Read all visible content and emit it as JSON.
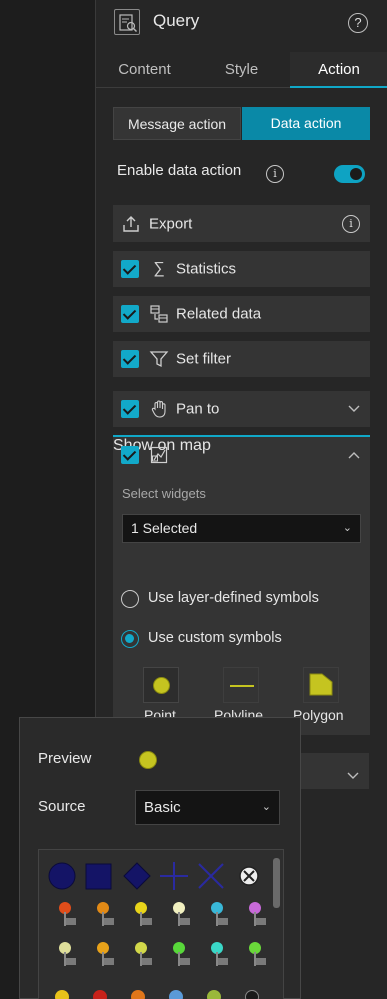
{
  "header": {
    "title": "Query",
    "help": "?"
  },
  "tabs": [
    {
      "label": "Content"
    },
    {
      "label": "Style"
    },
    {
      "label": "Action"
    }
  ],
  "segmented": {
    "message_action": "Message action",
    "data_action": "Data action"
  },
  "enable": {
    "label": "Enable data action",
    "enabled": true
  },
  "actions": {
    "export": "Export",
    "statistics": "Statistics",
    "related_data": "Related data",
    "set_filter": "Set filter",
    "pan_to": "Pan to",
    "show_on_map": "Show on map"
  },
  "show_on_map": {
    "select_widgets_label": "Select widgets",
    "select_widgets_value": "1 Selected",
    "radio_layer": "Use layer-defined symbols",
    "radio_custom": "Use custom symbols",
    "symbol_types": {
      "point": "Point",
      "polyline": "Polyline",
      "polygon": "Polygon"
    }
  },
  "symbol_popup": {
    "preview_label": "Preview",
    "source_label": "Source",
    "source_value": "Basic"
  },
  "colors": {
    "accent": "#10a8c8",
    "symbol_yellow": "#c5c420",
    "symbol_navy": "#1a1a7a"
  }
}
